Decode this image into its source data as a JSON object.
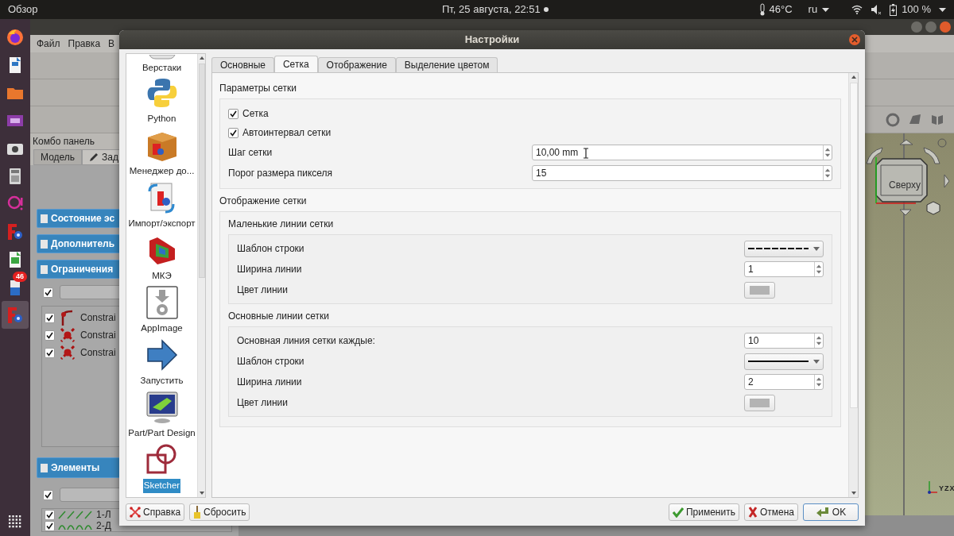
{
  "topbar": {
    "activities": "Обзор",
    "clock": "Пт, 25 августа, 22:51",
    "temperature": "46°C",
    "language": "ru",
    "battery": "100 %"
  },
  "dock": {
    "badge": "46"
  },
  "app": {
    "menu": [
      "Файл",
      "Правка",
      "В"
    ],
    "combo_title": "Комбо панель",
    "tabs": [
      {
        "label": "Модель",
        "selected": false
      },
      {
        "label": "Зад",
        "selected": true
      }
    ],
    "panels": [
      "Состояние эс",
      "Дополнитель",
      "Ограничения"
    ],
    "constraints_all_checked": true,
    "elements_all_checked": true,
    "constraints": [
      {
        "label": "Constrai",
        "checked": true,
        "kind": "tangent"
      },
      {
        "label": "Constrai",
        "checked": true,
        "kind": "point"
      },
      {
        "label": "Constrai",
        "checked": true,
        "kind": "point"
      }
    ],
    "elements_title": "Элементы",
    "elements": [
      {
        "label": "1-Л",
        "checked": true,
        "kind": "lines"
      },
      {
        "label": "2-Д",
        "checked": true,
        "kind": "arcs"
      }
    ],
    "navcube": "Сверху",
    "axes": [
      "Y",
      "Z",
      "X"
    ]
  },
  "dialog": {
    "title": "Настройки",
    "categories": [
      {
        "label": "Верстаки",
        "kind": "workbench",
        "selected": false
      },
      {
        "label": "Python",
        "kind": "python",
        "selected": false
      },
      {
        "label": "Менеджер до...",
        "kind": "addon",
        "selected": false
      },
      {
        "label": "Импорт/экспорт",
        "kind": "import",
        "selected": false
      },
      {
        "label": "МКЭ",
        "kind": "fem",
        "selected": false
      },
      {
        "label": "AppImage",
        "kind": "appimage",
        "selected": false
      },
      {
        "label": "Запустить",
        "kind": "run",
        "selected": false
      },
      {
        "label": "Part/Part Design",
        "kind": "part",
        "selected": false
      },
      {
        "label": "Sketcher",
        "kind": "sketcher",
        "selected": true
      }
    ],
    "tabs": [
      {
        "label": "Основные",
        "selected": false
      },
      {
        "label": "Сетка",
        "selected": true
      },
      {
        "label": "Отображение",
        "selected": false
      },
      {
        "label": "Выделение цветом",
        "selected": false
      }
    ],
    "sections": [
      {
        "title": "Параметры сетки",
        "rows": [
          {
            "kind": "checkbox",
            "label": "Сетка",
            "checked": true
          },
          {
            "kind": "checkbox",
            "label": "Автоинтервал сетки",
            "checked": true
          },
          {
            "kind": "spin",
            "label": "Шаг сетки",
            "value": "10,00 mm"
          },
          {
            "kind": "spin",
            "label": "Порог размера пикселя",
            "value": "15"
          }
        ]
      },
      {
        "title": "Отображение сетки",
        "groups": [
          {
            "title": "Маленькие линии сетки",
            "rows": [
              {
                "kind": "pattern",
                "label": "Шаблон строки",
                "dashed": true
              },
              {
                "kind": "spin",
                "label": "Ширина линии",
                "value": "1"
              },
              {
                "kind": "color",
                "label": "Цвет линии",
                "color": "#b3b3b3"
              }
            ]
          },
          {
            "title": "Основные линии сетки",
            "rows": [
              {
                "kind": "spin",
                "label": "Основная линия сетки каждые:",
                "value": "10"
              },
              {
                "kind": "pattern",
                "label": "Шаблон строки",
                "dashed": false
              },
              {
                "kind": "spin",
                "label": "Ширина линии",
                "value": "2"
              },
              {
                "kind": "color",
                "label": "Цвет линии",
                "color": "#b3b3b3"
              }
            ]
          }
        ]
      }
    ],
    "buttons_left": [
      {
        "label": "Справка",
        "kind": "help"
      },
      {
        "label": "Сбросить",
        "kind": "reset"
      }
    ],
    "buttons_right": [
      {
        "label": "Применить",
        "kind": "apply",
        "selected": false
      },
      {
        "label": "Отмена",
        "kind": "cancel",
        "selected": false
      },
      {
        "label": "OK",
        "kind": "ok",
        "selected": true
      }
    ]
  }
}
